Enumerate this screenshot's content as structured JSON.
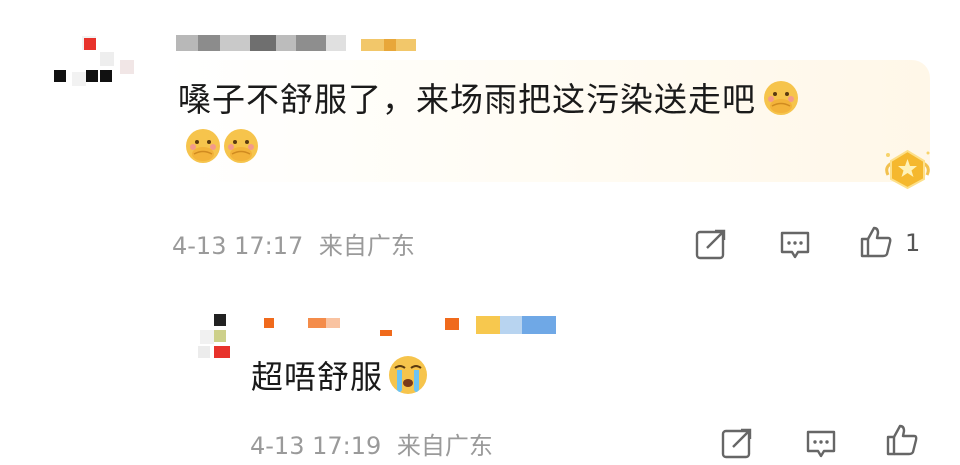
{
  "comment": {
    "text": "嗓子不舒服了，来场雨把这污染送走吧",
    "emoji_icon": "hand-over-mouth-emoji-icon",
    "timestamp": "4-13 17:17",
    "location": "来自广东",
    "like_count": "1"
  },
  "reply": {
    "text": "超唔舒服",
    "emoji_icon": "crying-emoji-icon",
    "timestamp": "4-13 17:19",
    "location": "来自广东"
  },
  "icons": {
    "share": "share-icon",
    "reply": "comment-icon",
    "like": "thumbs-up-icon",
    "badge": "crown-badge-icon"
  },
  "colors": {
    "meta_text": "#9a9a9a",
    "emoji_yellow": "#f6c44c",
    "accent_orange": "#f06a1c"
  }
}
